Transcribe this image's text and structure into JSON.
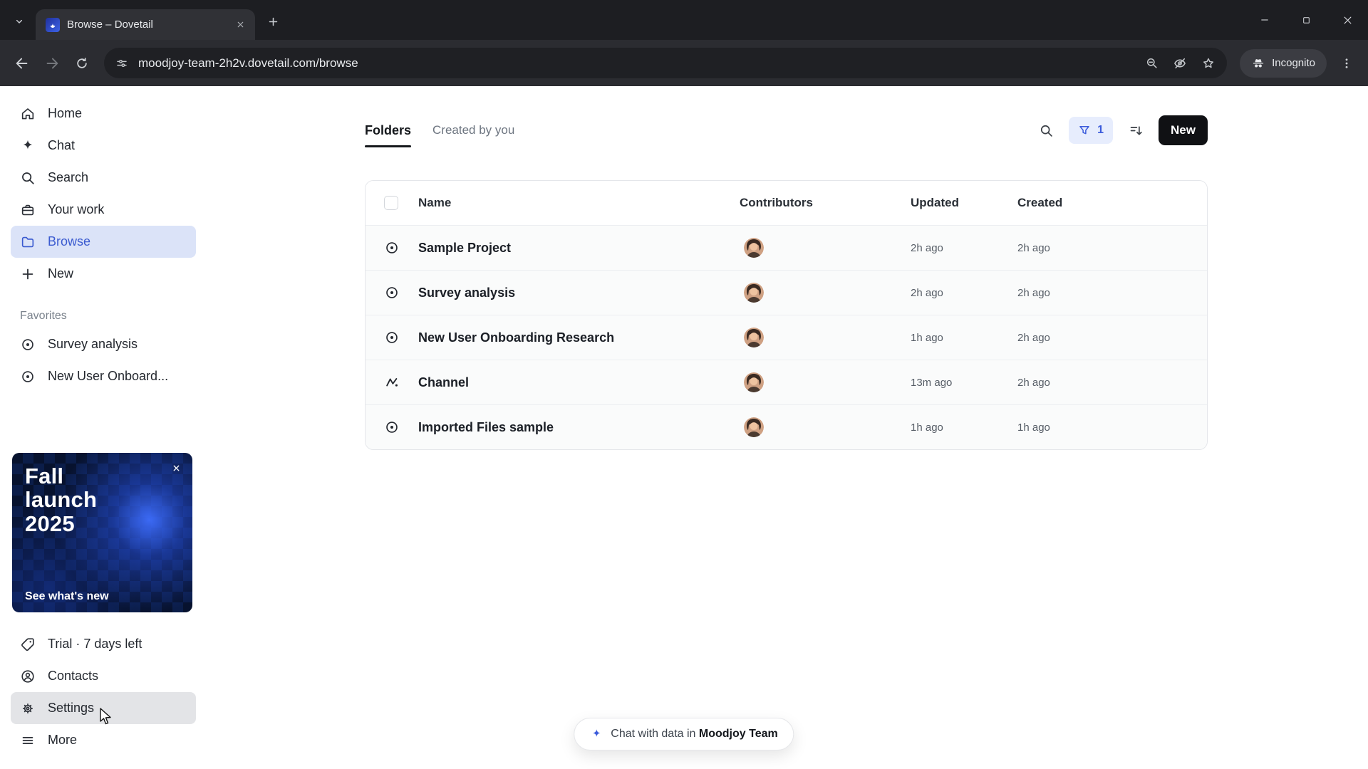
{
  "browser": {
    "tab_title": "Browse – Dovetail",
    "url": "moodjoy-team-2h2v.dovetail.com/browse",
    "incognito_label": "Incognito"
  },
  "sidebar": {
    "items": [
      {
        "label": "Home",
        "icon": "home-icon"
      },
      {
        "label": "Chat",
        "icon": "sparkle-icon"
      },
      {
        "label": "Search",
        "icon": "search-icon"
      },
      {
        "label": "Your work",
        "icon": "briefcase-icon"
      },
      {
        "label": "Browse",
        "icon": "folder-icon",
        "active": true
      },
      {
        "label": "New",
        "icon": "plus-icon"
      }
    ],
    "favorites_label": "Favorites",
    "favorites": [
      {
        "label": "Survey analysis",
        "icon": "target-icon"
      },
      {
        "label": "New User Onboard...",
        "icon": "target-icon"
      }
    ],
    "promo": {
      "title": "Fall\nlaunch\n2025",
      "link": "See what's new"
    },
    "footer": [
      {
        "label": "Trial · 7 days left",
        "icon": "tag-icon"
      },
      {
        "label": "Contacts",
        "icon": "person-icon"
      },
      {
        "label": "Settings",
        "icon": "gear-icon",
        "hovered": true
      },
      {
        "label": "More",
        "icon": "menu-icon"
      }
    ]
  },
  "main": {
    "tabs": [
      {
        "label": "Folders",
        "active": true
      },
      {
        "label": "Created by you",
        "active": false
      }
    ],
    "controls": {
      "filter_count": "1",
      "new_label": "New"
    },
    "table": {
      "headers": {
        "name": "Name",
        "contributors": "Contributors",
        "updated": "Updated",
        "created": "Created"
      },
      "rows": [
        {
          "name": "Sample Project",
          "icon": "target-icon",
          "updated": "2h ago",
          "created": "2h ago"
        },
        {
          "name": "Survey analysis",
          "icon": "target-icon",
          "updated": "2h ago",
          "created": "2h ago"
        },
        {
          "name": "New User Onboarding Research",
          "icon": "target-icon",
          "updated": "1h ago",
          "created": "2h ago"
        },
        {
          "name": "Channel",
          "icon": "channel-icon",
          "updated": "13m ago",
          "created": "2h ago"
        },
        {
          "name": "Imported Files sample",
          "icon": "target-icon",
          "updated": "1h ago",
          "created": "1h ago"
        }
      ]
    },
    "chat_pill": {
      "prefix": "Chat with data in",
      "team": "Moodjoy Team"
    }
  },
  "colors": {
    "accent_blue": "#3b5bdb",
    "sidebar_active_bg": "#dbe3f8",
    "new_button_bg": "#101114",
    "promo_bg": "#050d24",
    "chrome_dark": "#1d1e22"
  }
}
